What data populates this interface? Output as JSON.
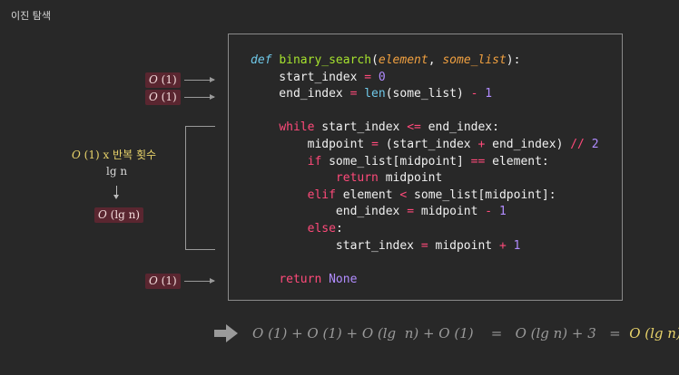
{
  "page": {
    "title": "이진 탐색"
  },
  "annotations": {
    "badge1": {
      "o": "O",
      "rest": " (1)"
    },
    "badge2": {
      "o": "O",
      "rest": " (1)"
    },
    "badge3": {
      "o": "O",
      "rest": " (lg n)"
    },
    "badge4": {
      "o": "O",
      "rest": " (1)"
    },
    "loop_label": {
      "o": "O",
      "rest": " (1)  x  반복 횟수"
    },
    "loop_lgn": "lg n"
  },
  "code": {
    "lines": [
      "def binary_search(element, some_list):",
      "start_index = 0",
      "end_index = len(some_list) - 1",
      "",
      "while start_index <= end_index:",
      "midpoint = (start_index + end_index) // 2",
      "if some_list[midpoint] == element:",
      "return midpoint",
      "elif element < some_list[midpoint]:",
      "end_index = midpoint - 1",
      "else:",
      "start_index = midpoint + 1",
      "",
      "return None"
    ]
  },
  "formula": {
    "text": "O (1) + O (1) + O (lg  n) + O (1)    =   O (lg n) + 3   =  ",
    "result": "O (lg n)"
  },
  "colors": {
    "background": "#282828",
    "badge": "#5a2630",
    "highlight": "#e8d36a",
    "keyword": "#ff4a7a",
    "function": "#a6e22e",
    "param": "#f0a040",
    "number": "#b18cff"
  }
}
